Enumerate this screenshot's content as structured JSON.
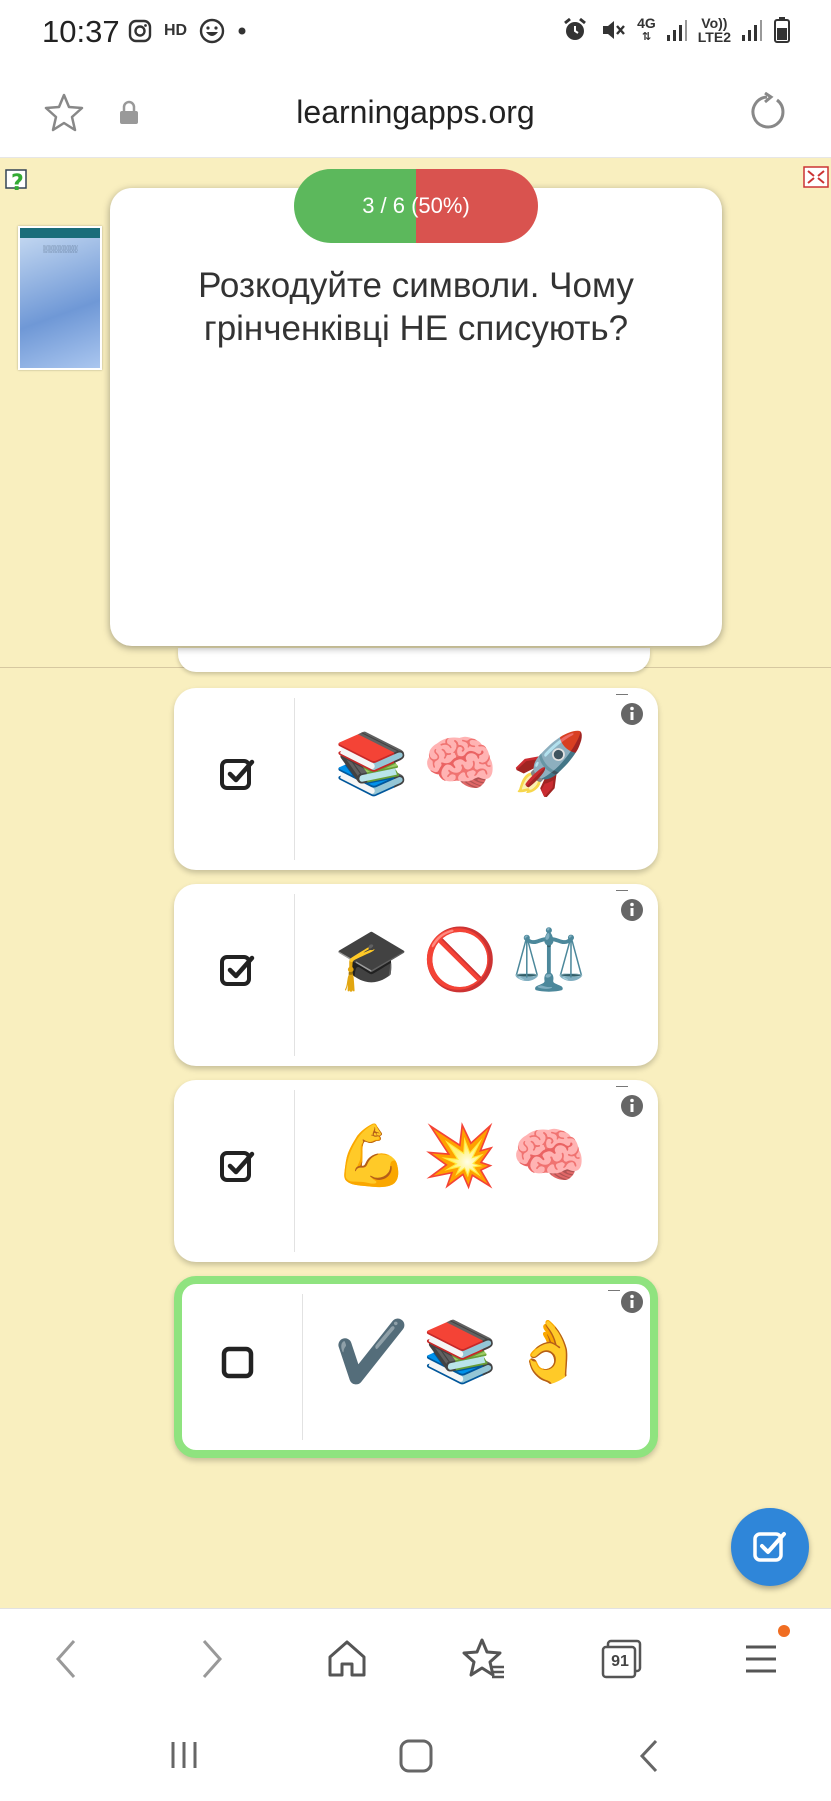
{
  "status": {
    "time": "10:37",
    "hd": "HD",
    "net_4g": "4G",
    "volte_1": "Vo))",
    "volte_2": "LTE2"
  },
  "address": {
    "url": "learningapps.org"
  },
  "quiz": {
    "progress_label": "3 / 6 (50%)",
    "progress_correct_fraction": 0.5,
    "question": "Розкодуйте символи. Чому грінченківці НЕ списують?",
    "answers": [
      {
        "symbols": [
          "📚",
          "🧠",
          "🚀"
        ],
        "checked": true,
        "selected": false
      },
      {
        "symbols": [
          "🎓",
          "🚫",
          "⚖️"
        ],
        "checked": true,
        "selected": false
      },
      {
        "symbols": [
          "💪",
          "💥",
          "🧠"
        ],
        "checked": true,
        "selected": false
      },
      {
        "symbols": [
          "✔️",
          "📚",
          "👌"
        ],
        "checked": false,
        "selected": true
      }
    ]
  },
  "browser_nav": {
    "tabs_count": "91"
  },
  "colors": {
    "background": "#f9efbf",
    "correct": "#5cb85c",
    "wrong": "#d9534f",
    "selected_border": "#8fe37f",
    "fab": "#2f86d9"
  }
}
